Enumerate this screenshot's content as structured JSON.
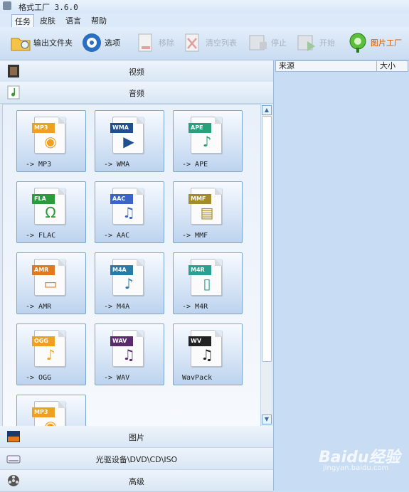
{
  "window": {
    "title": "格式工厂 3.6.0"
  },
  "menu": [
    "任务",
    "皮肤",
    "语言",
    "帮助"
  ],
  "toolbar": [
    {
      "label": "输出文件夹",
      "icon": "folder-icon",
      "enabled": true
    },
    {
      "label": "选项",
      "icon": "options-icon",
      "enabled": true
    },
    {
      "label": "移除",
      "icon": "remove-icon",
      "enabled": false
    },
    {
      "label": "清空列表",
      "icon": "clear-list-icon",
      "enabled": false
    },
    {
      "label": "停止",
      "icon": "stop-icon",
      "enabled": false
    },
    {
      "label": "开始",
      "icon": "start-icon",
      "enabled": false
    },
    {
      "label": "图片工厂",
      "icon": "picture-factory-icon",
      "enabled": true
    }
  ],
  "categories": {
    "video": "视频",
    "audio": "音频",
    "picture": "图片",
    "optical": "光驱设备\\DVD\\CD\\ISO",
    "advanced": "高级"
  },
  "audio_formats": [
    {
      "badge": "MP3",
      "label": "-> MP3",
      "color": "#f0a020",
      "icon": "speaker-icon"
    },
    {
      "badge": "WMA",
      "label": "-> WMA",
      "color": "#1f4f8f",
      "icon": "play-disc-icon"
    },
    {
      "badge": "APE",
      "label": "-> APE",
      "color": "#2aa07a",
      "icon": "headphone-note-icon"
    },
    {
      "badge": "FLA",
      "label": "-> FLAC",
      "color": "#2a9a3a",
      "icon": "headphones-icon"
    },
    {
      "badge": "AAC",
      "label": "-> AAC",
      "color": "#3a64c8",
      "icon": "note-speaker-icon"
    },
    {
      "badge": "MMF",
      "label": "-> MMF",
      "color": "#a38a2a",
      "icon": "document-icon"
    },
    {
      "badge": "AMR",
      "label": "-> AMR",
      "color": "#e07820",
      "icon": "device-icon"
    },
    {
      "badge": "M4A",
      "label": "-> M4A",
      "color": "#2a7aa8",
      "icon": "note-disc-icon"
    },
    {
      "badge": "M4R",
      "label": "-> M4R",
      "color": "#2aa090",
      "icon": "phone-icon"
    },
    {
      "badge": "OGG",
      "label": "-> OGG",
      "color": "#f0a020",
      "icon": "note-icon"
    },
    {
      "badge": "WAV",
      "label": "-> WAV",
      "color": "#5a2a6a",
      "icon": "notes-icon"
    },
    {
      "badge": "WV",
      "label": "WavPack",
      "color": "#222222",
      "icon": "green-note-icon"
    },
    {
      "badge": "MP3",
      "label": "",
      "color": "#f0a020",
      "icon": "speaker-icon"
    }
  ],
  "task_list": {
    "columns": [
      "来源",
      "大小"
    ]
  },
  "watermark": {
    "brand": "Baidu经验",
    "url": "jingyan.baidu.com"
  }
}
